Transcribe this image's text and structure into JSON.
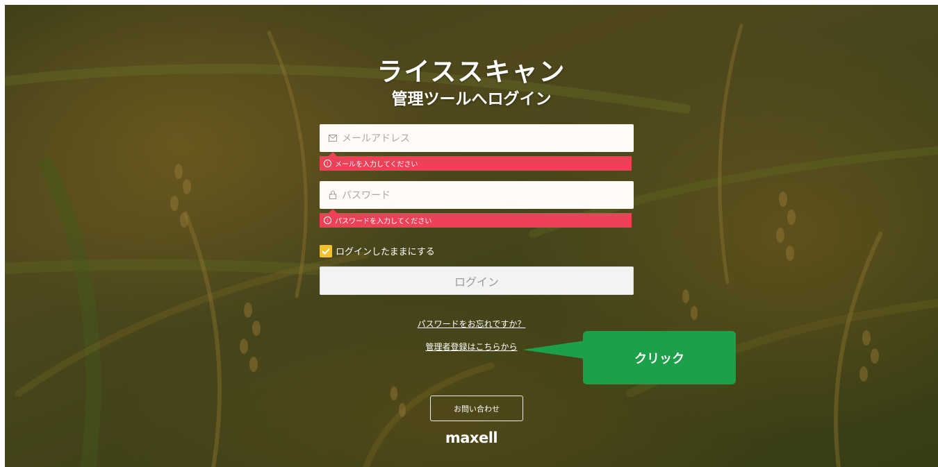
{
  "header": {
    "title": "ライススキャン",
    "subtitle": "管理ツールへログイン"
  },
  "form": {
    "email": {
      "placeholder": "メールアドレス",
      "icon": "mail-icon",
      "error": "メールを入力してください"
    },
    "password": {
      "placeholder": "パスワード",
      "icon": "lock-icon",
      "error": "パスワードを入力してください"
    },
    "remember": {
      "label": "ログインしたままにする",
      "checked": true
    },
    "login_button": "ログイン"
  },
  "links": {
    "forgot_password": "パスワードをお忘れですか？",
    "register": "管理者登録はこちらから"
  },
  "annotation": {
    "callout": "クリック"
  },
  "footer": {
    "contact_button": "お問い合わせ",
    "logo_text": "maxell"
  },
  "colors": {
    "error_bg": "#ec4157",
    "checkbox": "#f1c12e",
    "callout_bg": "#1ca04a"
  }
}
